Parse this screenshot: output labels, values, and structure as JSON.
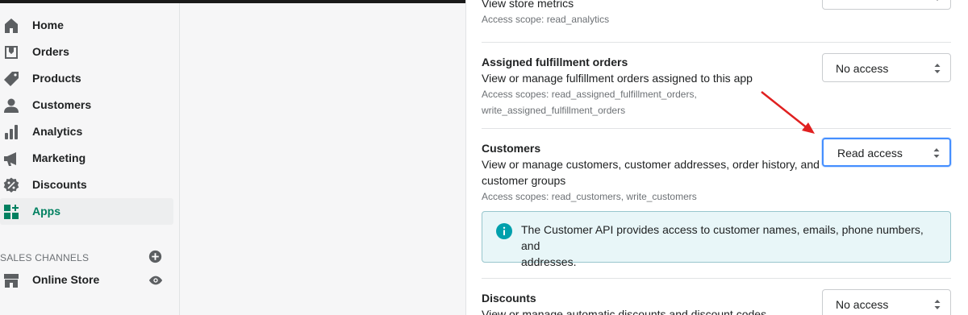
{
  "sidebar": {
    "items": [
      {
        "label": "Home",
        "icon": "home-icon"
      },
      {
        "label": "Orders",
        "icon": "orders-icon"
      },
      {
        "label": "Products",
        "icon": "tag-icon"
      },
      {
        "label": "Customers",
        "icon": "person-icon"
      },
      {
        "label": "Analytics",
        "icon": "bar-chart-icon"
      },
      {
        "label": "Marketing",
        "icon": "megaphone-icon"
      },
      {
        "label": "Discounts",
        "icon": "discount-icon"
      },
      {
        "label": "Apps",
        "icon": "apps-icon",
        "active": true
      }
    ],
    "sales_channels_label": "SALES CHANNELS",
    "online_store_label": "Online Store"
  },
  "scopes": {
    "analytics": {
      "desc": "View store metrics",
      "scope": "Access scope: read_analytics"
    },
    "fulfillment": {
      "title": "Assigned fulfillment orders",
      "desc": "View or manage fulfillment orders assigned to this app",
      "scope_line1": "Access scopes: read_assigned_fulfillment_orders,",
      "scope_line2": "write_assigned_fulfillment_orders",
      "select_value": "No access"
    },
    "customers": {
      "title": "Customers",
      "desc_line1": "View or manage customers, customer addresses, order history, and",
      "desc_line2": "customer groups",
      "scope": "Access scopes: read_customers, write_customers",
      "select_value": "Read access",
      "banner_line1": "The Customer API provides access to customer names, emails, phone numbers, and",
      "banner_line2": "addresses."
    },
    "discounts": {
      "title": "Discounts",
      "desc": "View or manage automatic discounts and discount codes",
      "select_value": "No access"
    }
  },
  "colors": {
    "accent": "#008060",
    "focus": "#458fff",
    "annotation_arrow": "#e02020",
    "info": "#00a0ac"
  }
}
